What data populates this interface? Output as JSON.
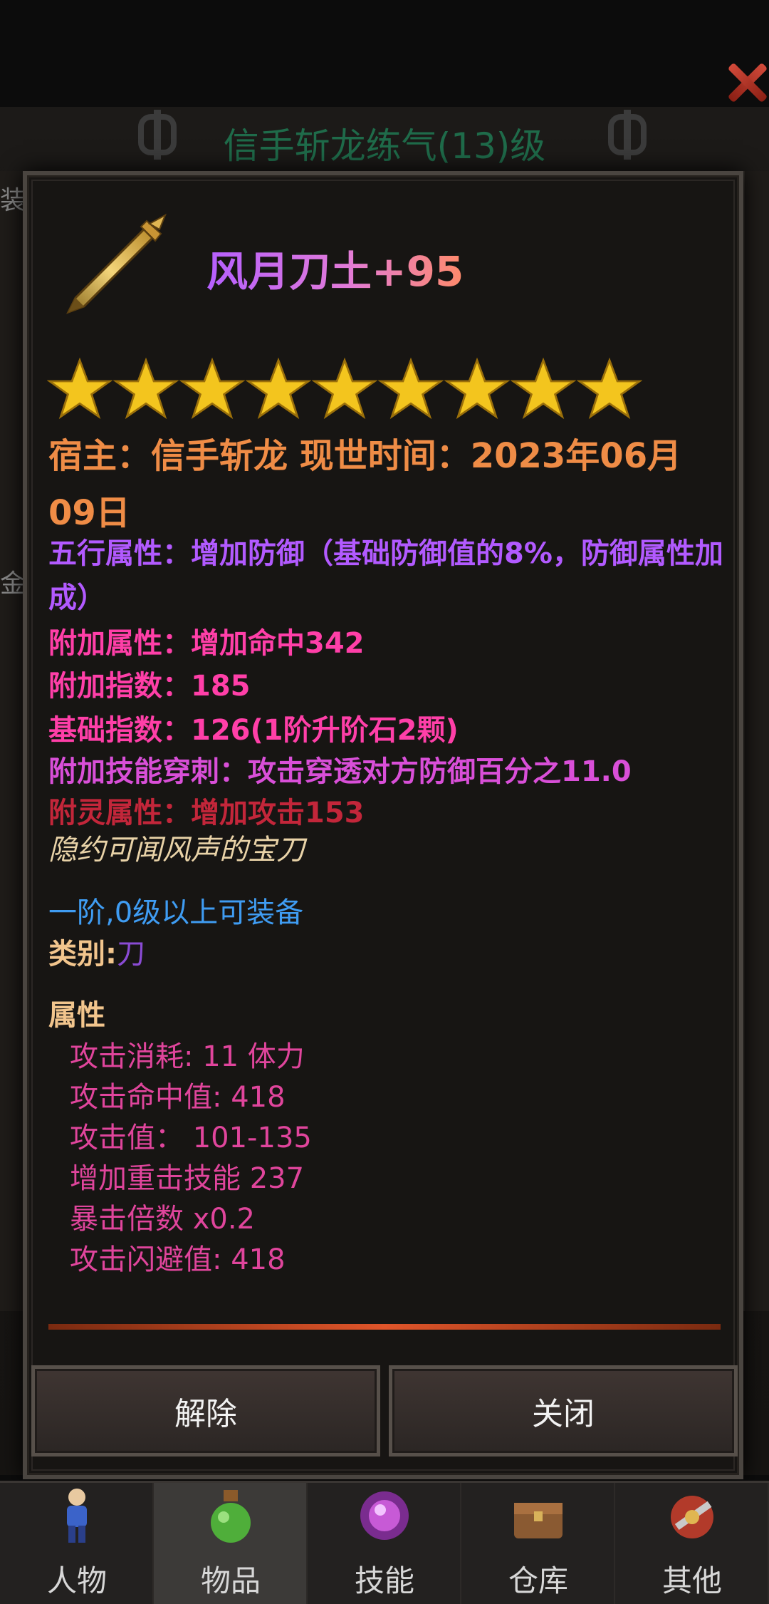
{
  "background": {
    "title": "信手斩龙练气(13)级",
    "side_labels": [
      "装",
      "金"
    ]
  },
  "item": {
    "name": "风月刀土+95",
    "star_count": 9,
    "owner_line": "宿主：信手斩龙 现世时间：2023年06月09日",
    "wuxing": "五行属性：增加防御（基础防御值的8%，防御属性加成）",
    "extra_attr": "附加属性：增加命中342",
    "extra_index": "附加指数：185",
    "base_index": "基础指数：126(1阶升阶石2颗)",
    "skill_pierce": "附加技能穿刺：攻击穿透对方防御百分之11.0",
    "spirit_attr": "附灵属性：增加攻击153",
    "flavor": "隐约可闻风声的宝刀",
    "requirement": "一阶,0级以上可装备",
    "category_label": "类别:",
    "category_value": "刀",
    "props_header": "属性",
    "props": [
      "攻击消耗: 11 体力",
      "攻击命中值: 418",
      "攻击值：  101-135",
      "增加重击技能 237",
      "暴击倍数 x0.2",
      "攻击闪避值: 418"
    ]
  },
  "buttons": {
    "unequip": "解除",
    "close": "关闭"
  },
  "nav": [
    {
      "label": "人物",
      "icon": "character-icon",
      "active": false
    },
    {
      "label": "物品",
      "icon": "potion-icon",
      "active": true
    },
    {
      "label": "技能",
      "icon": "skill-orb-icon",
      "active": false
    },
    {
      "label": "仓库",
      "icon": "chest-icon",
      "active": false
    },
    {
      "label": "其他",
      "icon": "misc-icon",
      "active": false
    }
  ],
  "colors": {
    "owner": "#ef8c46",
    "wuxing": "#b25aff",
    "attr_pink": "#ff3fa8",
    "attr_magenta": "#d94fd8",
    "attr_red": "#c3263a",
    "requirement": "#3f9cf2",
    "prop": "#e0459c"
  }
}
